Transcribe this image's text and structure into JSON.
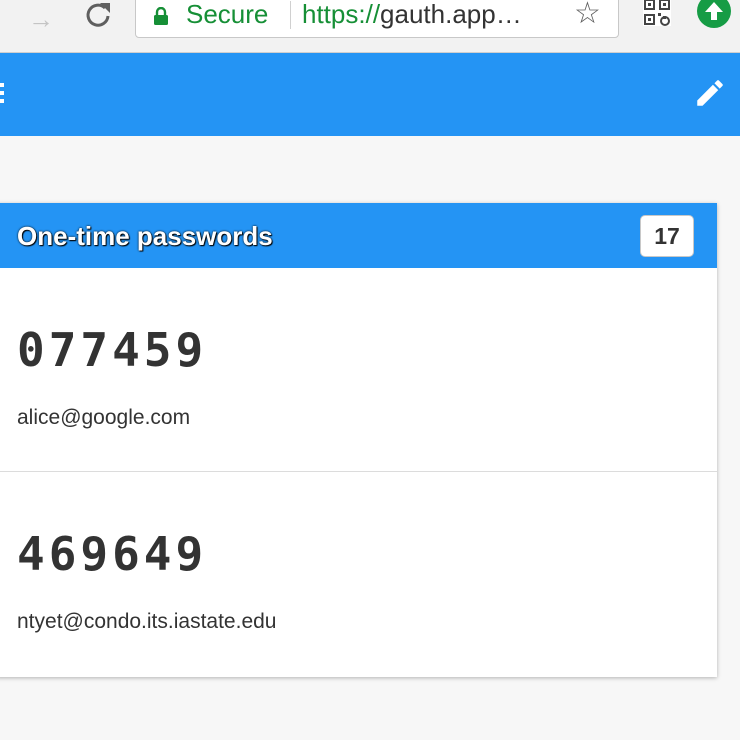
{
  "browser": {
    "secure_label": "Secure",
    "url_scheme": "https://",
    "url_rest": "gauth.app…",
    "colors": {
      "secure_green": "#168f36",
      "update_green": "#169c45"
    },
    "icons": [
      "forward-arrow-icon",
      "reload-icon",
      "lock-icon",
      "bookmark-star-icon",
      "qr-code-extension-icon",
      "update-arrow-icon"
    ]
  },
  "toolbar": {
    "color": "#2494f4",
    "icons": [
      "menu-icon",
      "edit-icon"
    ]
  },
  "otp_card": {
    "title": "One-time passwords",
    "countdown": "17",
    "entries": [
      {
        "code": "077459",
        "account": "alice@google.com"
      },
      {
        "code": "469649",
        "account": "ntyet@condo.its.iastate.edu"
      }
    ]
  }
}
